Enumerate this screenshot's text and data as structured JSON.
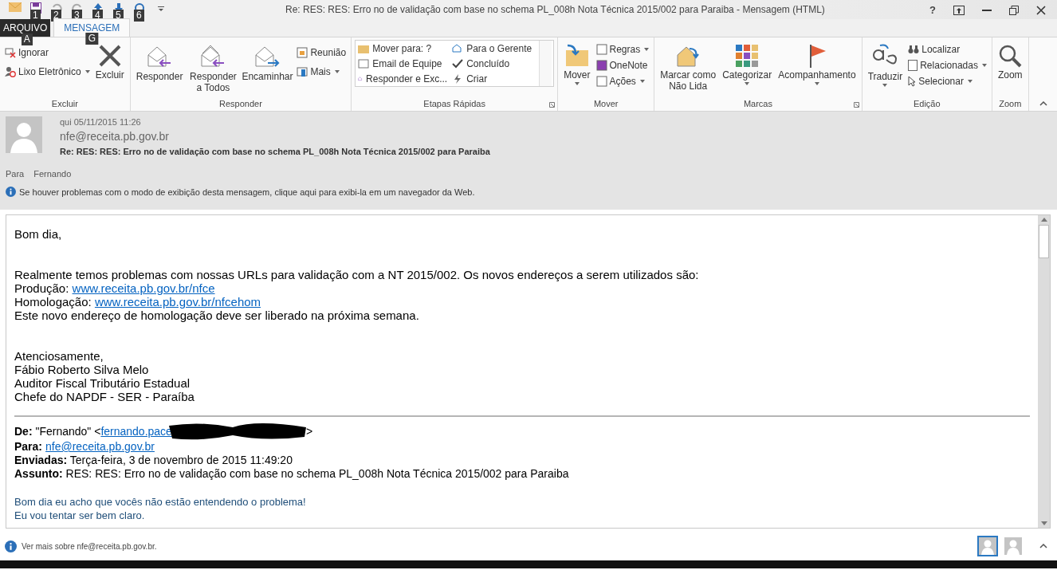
{
  "window": {
    "title": "Re: RES: RES: Erro no de validação com base no schema PL_008h Nota Técnica 2015/002 para Paraiba - Mensagem (HTML)",
    "help": "?"
  },
  "quick_access": [
    {
      "disabled": false
    },
    {
      "keytip": "1"
    },
    {
      "keytip": "2",
      "disabled": true
    },
    {
      "keytip": "3",
      "disabled": true
    },
    {
      "keytip": "4"
    },
    {
      "keytip": "5"
    },
    {
      "keytip": "6"
    }
  ],
  "tabs": [
    {
      "label": "ARQUIVO",
      "keytip": "A",
      "selected": false
    },
    {
      "label": "MENSAGEM",
      "keytip": "G",
      "selected": true
    }
  ],
  "ribbon": {
    "groups": [
      {
        "name": "Excluir",
        "items": [
          {
            "label": "Ignorar",
            "dropdown": false
          },
          {
            "label": "Lixo Eletrônico",
            "dropdown": true
          },
          {
            "label": "Excluir",
            "dropdown": false
          }
        ]
      },
      {
        "name": "Responder",
        "items": [
          {
            "label": "Responder",
            "dropdown": false
          },
          {
            "label": "Responder a Todos",
            "dropdown": false
          },
          {
            "label": "Encaminhar",
            "dropdown": false
          },
          {
            "label": "Reunião",
            "dropdown": false
          },
          {
            "label": "Mais",
            "dropdown": true
          }
        ]
      },
      {
        "name": "Etapas Rápidas",
        "items": [
          {
            "label": "Mover para: ?"
          },
          {
            "label": "Email de Equipe"
          },
          {
            "label": "Responder e Exc..."
          },
          {
            "label": "Para o Gerente"
          },
          {
            "label": "Concluído"
          },
          {
            "label": "Criar"
          }
        ]
      },
      {
        "name": "Mover",
        "items": [
          {
            "label": "Mover",
            "dropdown": true
          },
          {
            "label": "Regras",
            "dropdown": true
          },
          {
            "label": "OneNote",
            "dropdown": false
          },
          {
            "label": "Ações",
            "dropdown": true
          }
        ]
      },
      {
        "name": "Marcas",
        "items": [
          {
            "label": "Marcar como Não Lida",
            "dropdown": false
          },
          {
            "label": "Categorizar",
            "dropdown": true
          },
          {
            "label": "Acompanhamento",
            "dropdown": true
          }
        ]
      },
      {
        "name": "Edição",
        "items": [
          {
            "label": "Traduzir",
            "dropdown": true
          },
          {
            "label": "Localizar",
            "dropdown": false
          },
          {
            "label": "Relacionadas",
            "dropdown": true
          },
          {
            "label": "Selecionar",
            "dropdown": true
          }
        ]
      },
      {
        "name": "Zoom",
        "items": [
          {
            "label": "Zoom",
            "dropdown": false
          }
        ]
      }
    ]
  },
  "header": {
    "date": "qui 05/11/2015 11:26",
    "sender": "nfe@receita.pb.gov.br",
    "subject": "Re: RES: RES: Erro no de validação com base no schema PL_008h Nota Técnica 2015/002 para Paraiba",
    "to_label": "Para",
    "to": "Fernando",
    "info": "Se houver problemas com o modo de exibição desta mensagem, clique aqui para exibi-la em um navegador da Web."
  },
  "body": {
    "greeting": "Bom dia,",
    "lines": [
      {
        "text": "Realmente temos problemas com nossas URLs para validação com a NT 2015/002. Os novos endereços a serem utilizados são:"
      },
      {
        "text": "Produção: ",
        "link": "www.receita.pb.gov.br/nfce"
      },
      {
        "text": "Homologação: ",
        "link": "www.receita.pb.gov.br/nfcehom"
      },
      {
        "text": "Este novo endereço de homologação deve ser liberado na próxima semana."
      }
    ],
    "signature": [
      "Atenciosamente,",
      "Fábio Roberto Silva Melo",
      "Auditor Fiscal Tributário Estadual",
      "Chefe do NAPDF - SER - Paraíba"
    ],
    "forward": [
      {
        "label": "De:",
        "text": " \"Fernando\" <",
        "link": "fernando.pace",
        "redacted": true,
        "tail": ">"
      },
      {
        "label": "Para:",
        "link": "nfe@receita.pb.gov.br",
        "redacted": false
      },
      {
        "label": "Enviadas:",
        "text": " Terça-feira, 3 de novembro de 2015 11:49:20",
        "redacted": false
      },
      {
        "label": "Assunto:",
        "text": " RES: RES: Erro no de validação com base no schema PL_008h Nota Técnica 2015/002 para Paraiba",
        "redacted": false
      }
    ],
    "reply": [
      "Bom dia eu acho que vocês não estão entendendo o problema!",
      "Eu vou tentar ser bem claro."
    ]
  },
  "people_pane": {
    "text": "Ver mais sobre nfe@receita.pb.gov.br.",
    "avatars": [
      {
        "selected": true
      },
      {
        "selected": false
      }
    ]
  }
}
